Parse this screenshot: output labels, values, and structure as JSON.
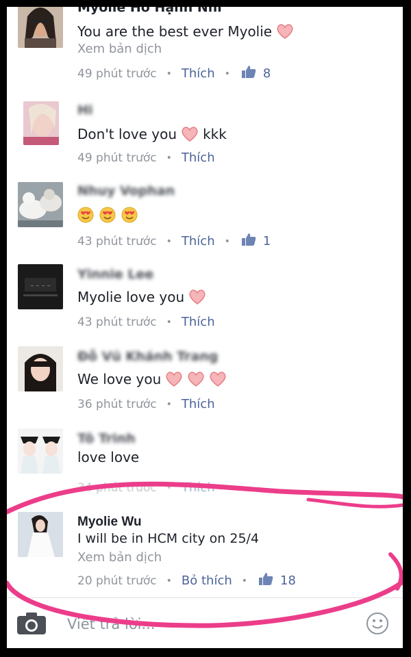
{
  "comments": [
    {
      "name": "Myolie Hồ Hạnh Nhi",
      "text": "You are the best ever Myolie",
      "translate": "Xem bản dịch",
      "time": "49 phút trước",
      "like_label": "Thích",
      "like_count": "8",
      "avatar": "avatar-woman-dark-hair"
    },
    {
      "name": "Hi",
      "text": "Don't love you",
      "text_after": "kkk",
      "time": "49 phút trước",
      "like_label": "Thích",
      "avatar": "avatar-blonde-woman"
    },
    {
      "name": "Nhuy Vophan",
      "time": "43 phút trước",
      "like_label": "Thích",
      "like_count": "1",
      "avatar": "avatar-cats"
    },
    {
      "name": "Yinnie Lee",
      "text": "Myolie love you",
      "time": "43 phút trước",
      "like_label": "Thích",
      "avatar": "avatar-dark-shirt"
    },
    {
      "name": "Đỗ Vũ Khánh Trang",
      "text": "We love you",
      "time": "36 phút trước",
      "like_label": "Thích",
      "avatar": "avatar-girl-long-hair"
    },
    {
      "name": "Tô Trinh",
      "text": "love love",
      "time": "34 phút trước",
      "like_label": "Thích",
      "avatar": "avatar-costume-pair"
    },
    {
      "name": "Myolie Wu",
      "text": "I will be in HCM city on 25/4",
      "translate": "Xem bản dịch",
      "time": "20 phút trước",
      "like_label": "Bỏ thích",
      "like_count": "18",
      "avatar": "avatar-woman-white-dress"
    }
  ],
  "composer": {
    "placeholder": "Viết trả lời...",
    "camera_icon": "camera-icon",
    "emoji_icon": "smiley-icon"
  },
  "colors": {
    "highlight_scribble": "#ec3d8a",
    "link": "#4b6399",
    "meta_text": "#90949c"
  }
}
